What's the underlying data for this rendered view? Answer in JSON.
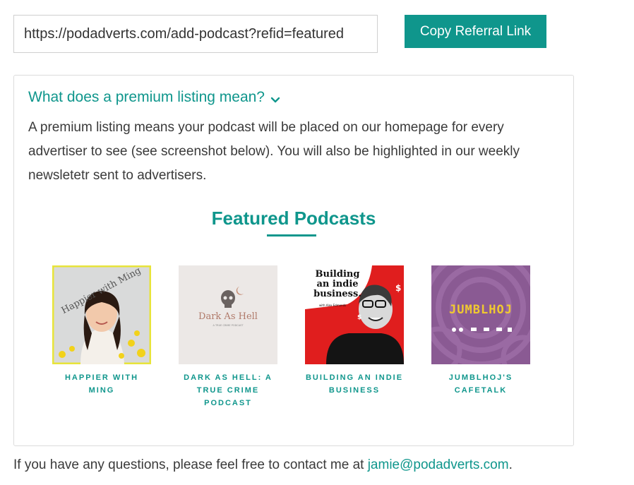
{
  "referral": {
    "url_value": "https://podadverts.com/add-podcast?refid=featured",
    "copy_button_label": "Copy Referral Link"
  },
  "faq": {
    "question": "What does a premium listing mean?",
    "answer": "A premium listing means your podcast will be placed on our homepage for every advertiser to see (see screenshot below). You will also be highlighted in our weekly newsletetr sent to advertisers.",
    "chevron_icon": "chevron-down-icon"
  },
  "featured": {
    "title": "Featured Podcasts",
    "podcasts": [
      {
        "title": "Happier with Ming",
        "cover_text": "Happier with Ming",
        "icon": "podcast-cover-image"
      },
      {
        "title": "Dark as Hell: A True Crime Podcast",
        "cover_text": "Dark As Hell",
        "cover_subtext": "A TRUE CRIME PODCAST",
        "icon": "podcast-cover-image"
      },
      {
        "title": "Building an Indie Business",
        "cover_text": "Building an indie business.",
        "cover_subtext": "with Alex Edmonds",
        "icon": "podcast-cover-image"
      },
      {
        "title": "Jumblhoj's Cafetalk",
        "cover_text": "JUMBLHOJ",
        "icon": "podcast-cover-image"
      }
    ]
  },
  "footer": {
    "text": "If you have any questions, please feel free to contact me at ",
    "email": "jamie@podadverts.com",
    "end": "."
  },
  "colors": {
    "accent": "#0f968c",
    "text": "#3a3a3a"
  }
}
